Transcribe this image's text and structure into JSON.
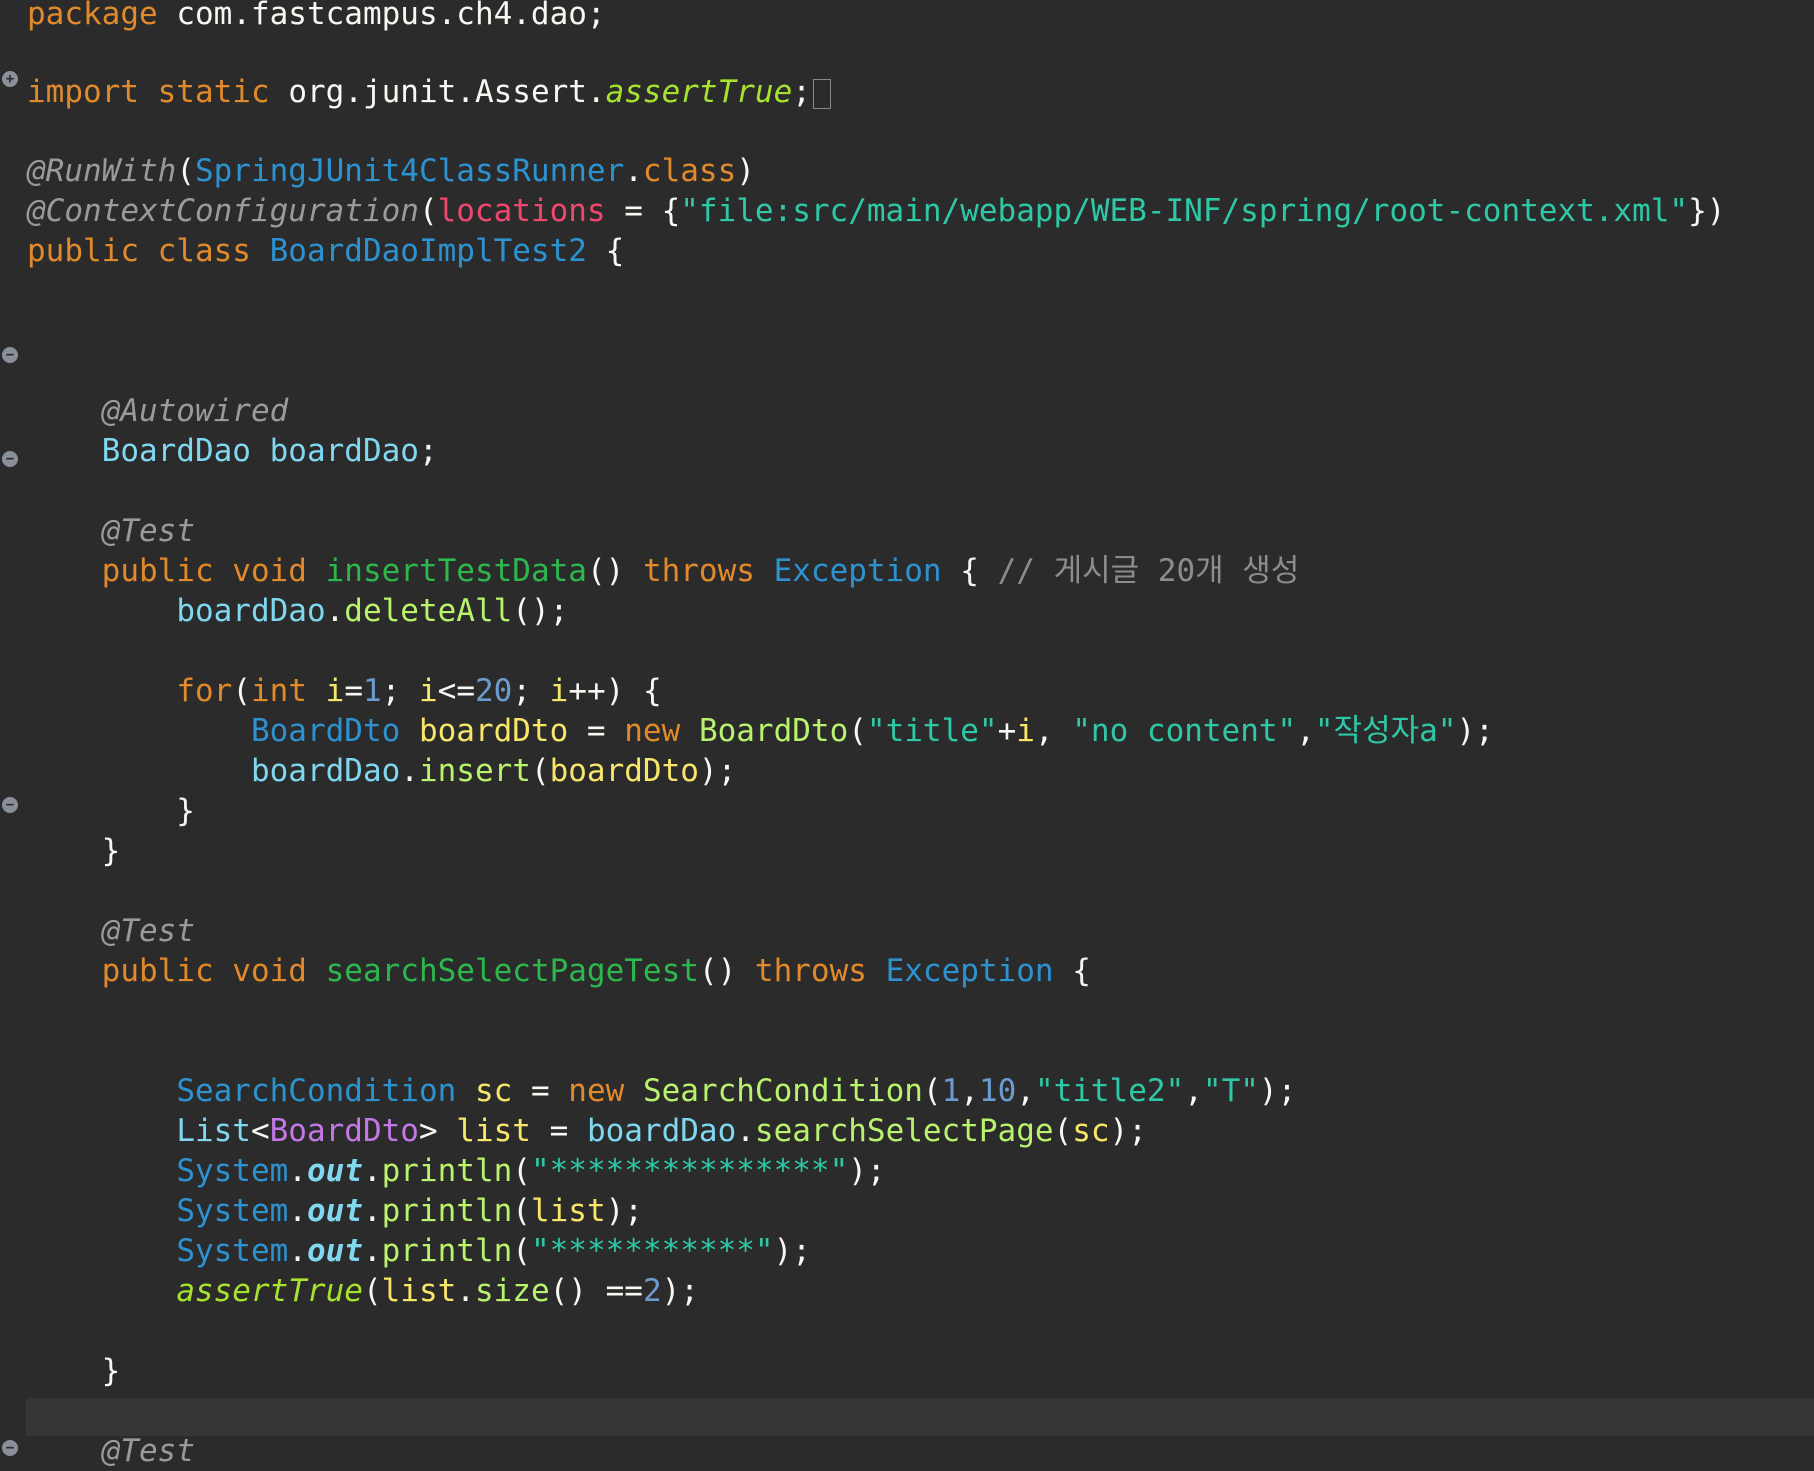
{
  "editor": {
    "package_kw": "package",
    "package_name": "com.fastcampus.ch4.dao;",
    "import_kw": "import static",
    "import_path": "org.junit.Assert.",
    "import_member": "assertTrue",
    "semicolon": ";",
    "run_with_ann": "@RunWith",
    "runner_class": "SpringJUnit4ClassRunner",
    "dot_class_kw": "class",
    "ctx_ann": "@ContextConfiguration",
    "locations_param": "locations",
    "locations_value": "\"file:src/main/webapp/WEB-INF/spring/root-context.xml\"",
    "class_kw": "public class",
    "class_name": "BoardDaoImplTest2",
    "autowired_ann": "@Autowired",
    "field_type": "BoardDao",
    "field_name": "boardDao",
    "test_ann": "@Test",
    "public_void": "public void",
    "method1_name": "insertTestData",
    "throws_kw": "throws",
    "exception_cls": "Exception",
    "method1_comment": "// 게시글 20개 생성",
    "delete_all": "deleteAll",
    "for_kw": "for",
    "int_kw": "int",
    "loop_var": "i",
    "num_1": "1",
    "num_20": "20",
    "dto_type": "BoardDto",
    "dto_var": "boardDto",
    "new_kw": "new",
    "str_title": "\"title\"",
    "str_no_content": "\"no content\"",
    "str_writer": "\"작성자a\"",
    "insert_call": "insert",
    "method2_name": "searchSelectPageTest",
    "sc_type": "SearchCondition",
    "sc_var": "sc",
    "num_10": "10",
    "str_title2": "\"title2\"",
    "str_T": "\"T\"",
    "list_type": "List",
    "list_var": "list",
    "search_call": "searchSelectPage",
    "system_cls": "System",
    "out_field": "out",
    "println": "println",
    "str_stars1": "\"***************\"",
    "str_stars2": "\"***********\"",
    "assert_true": "assertTrue",
    "size_call": "size",
    "num_2": "2"
  }
}
